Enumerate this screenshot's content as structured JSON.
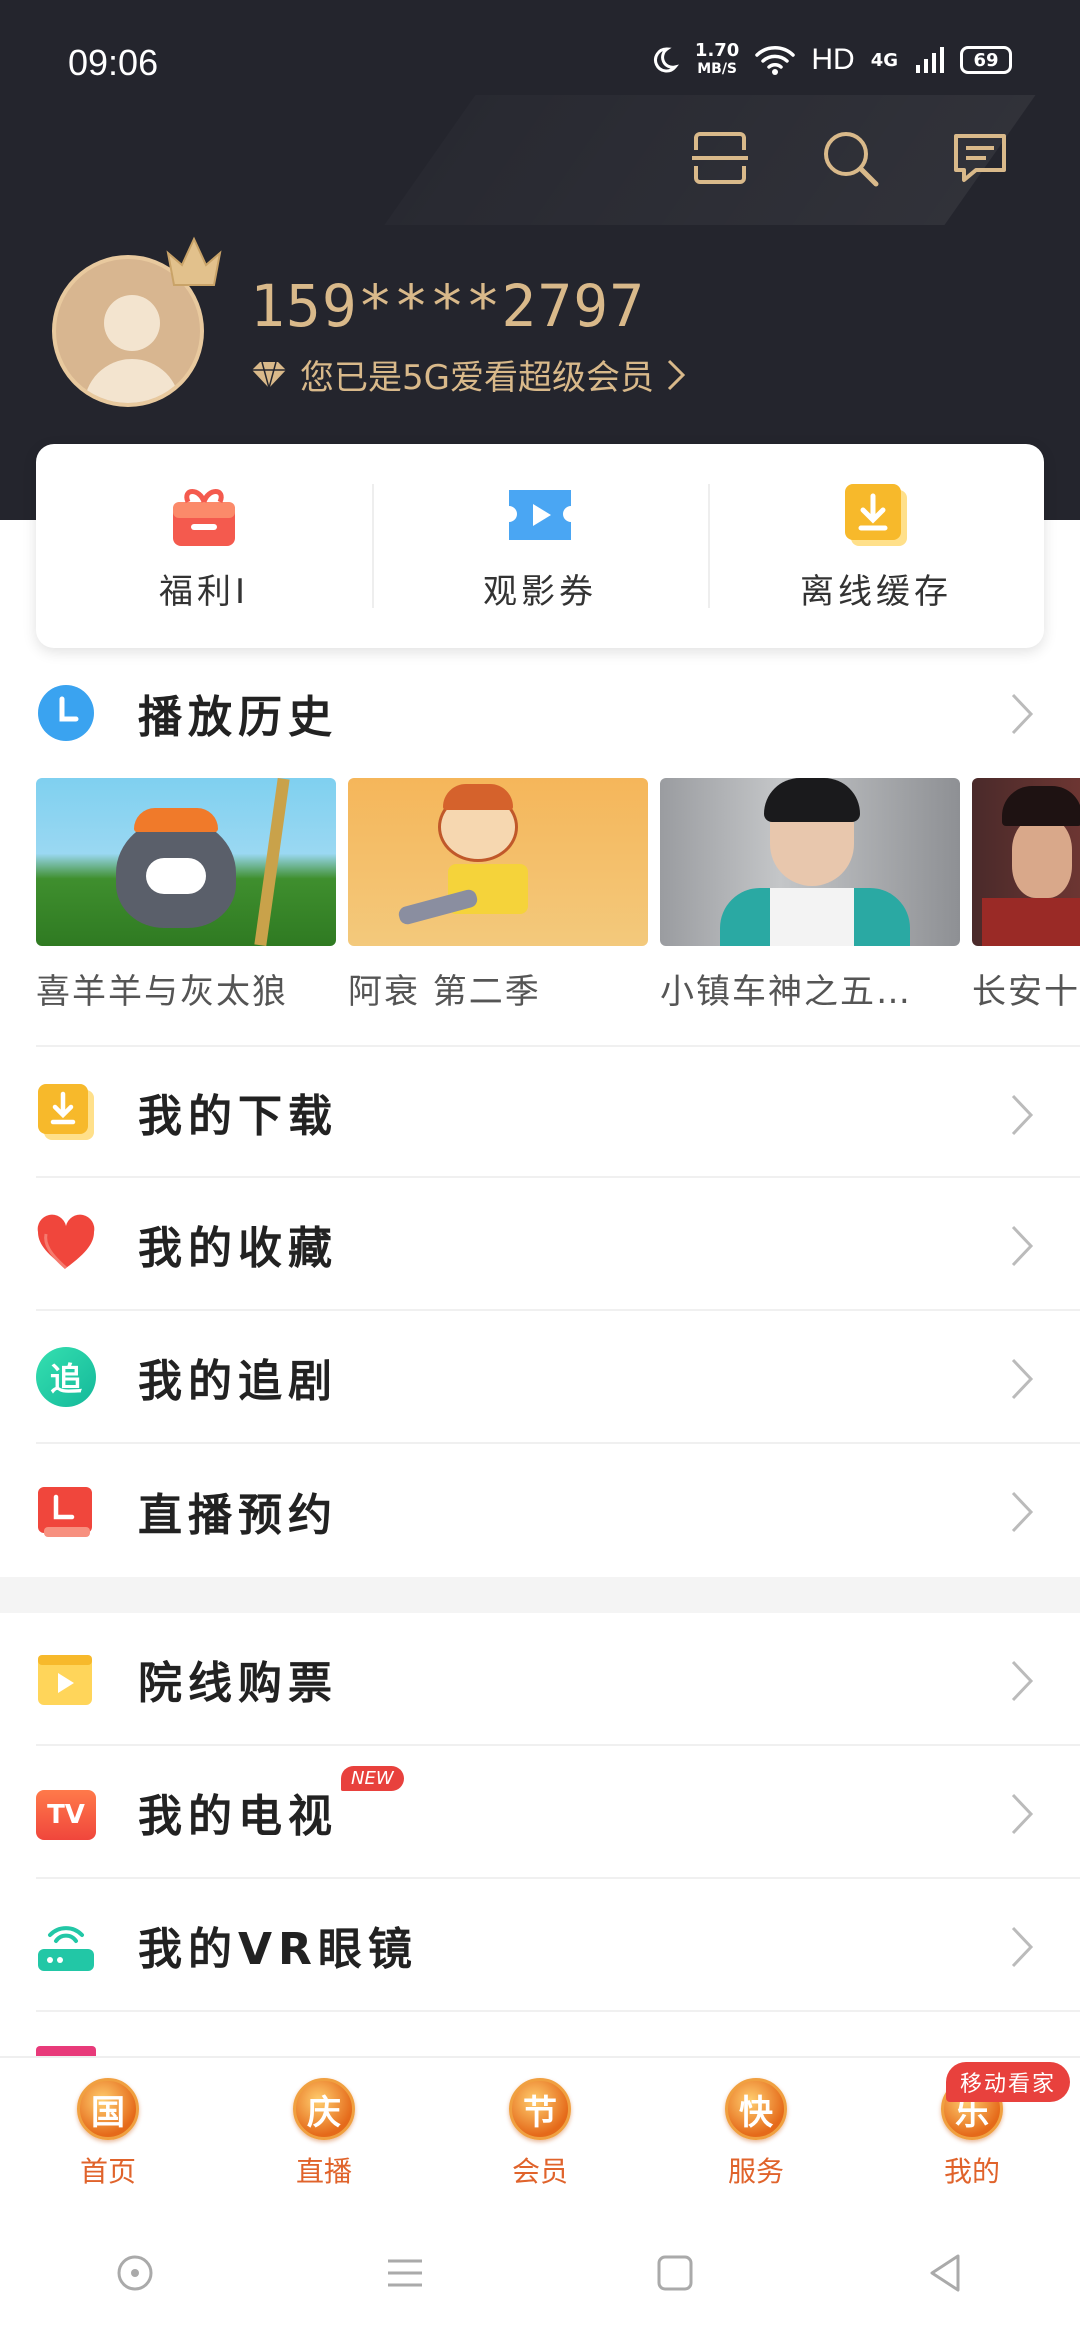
{
  "status_bar": {
    "time": "09:06",
    "speed_value": "1.70",
    "speed_unit": "MB/S",
    "hd": "HD",
    "network": "4G",
    "battery": "69"
  },
  "profile": {
    "phone": "159****2797",
    "vip_text": "您已是5G爱看超级会员"
  },
  "quick_actions": [
    {
      "label": "福利I",
      "icon": "gift-icon"
    },
    {
      "label": "观影券",
      "icon": "ticket-icon"
    },
    {
      "label": "离线缓存",
      "icon": "download-icon"
    }
  ],
  "history": {
    "title": "播放历史",
    "items": [
      {
        "caption": "喜羊羊与灰太狼"
      },
      {
        "caption": "阿衰 第二季"
      },
      {
        "caption": "小镇车神之五…"
      },
      {
        "caption": "长安十"
      }
    ]
  },
  "menu": [
    {
      "label": "我的下载",
      "icon": "download-icon"
    },
    {
      "label": "我的收藏",
      "icon": "heart-icon"
    },
    {
      "label": "我的追剧",
      "icon": "follow-icon",
      "icon_text": "追"
    },
    {
      "label": "直播预约",
      "icon": "live-reserve-icon"
    },
    {
      "label": "院线购票",
      "icon": "cinema-ticket-icon"
    },
    {
      "label": "我的电视",
      "icon": "tv-icon",
      "icon_text": "TV",
      "badge": "NEW"
    },
    {
      "label": "我的VR眼镜",
      "icon": "vr-icon"
    }
  ],
  "tabs": [
    {
      "label": "首页",
      "glyph": "国"
    },
    {
      "label": "直播",
      "glyph": "庆"
    },
    {
      "label": "会员",
      "glyph": "节"
    },
    {
      "label": "服务",
      "glyph": "快"
    },
    {
      "label": "我的",
      "glyph": "乐"
    }
  ],
  "promo_badge": "移动看家",
  "colors": {
    "header_bg": "#24252d",
    "gold": "#d9b98a",
    "tab_orange": "#e0632b",
    "accent_red": "#e8413d"
  }
}
